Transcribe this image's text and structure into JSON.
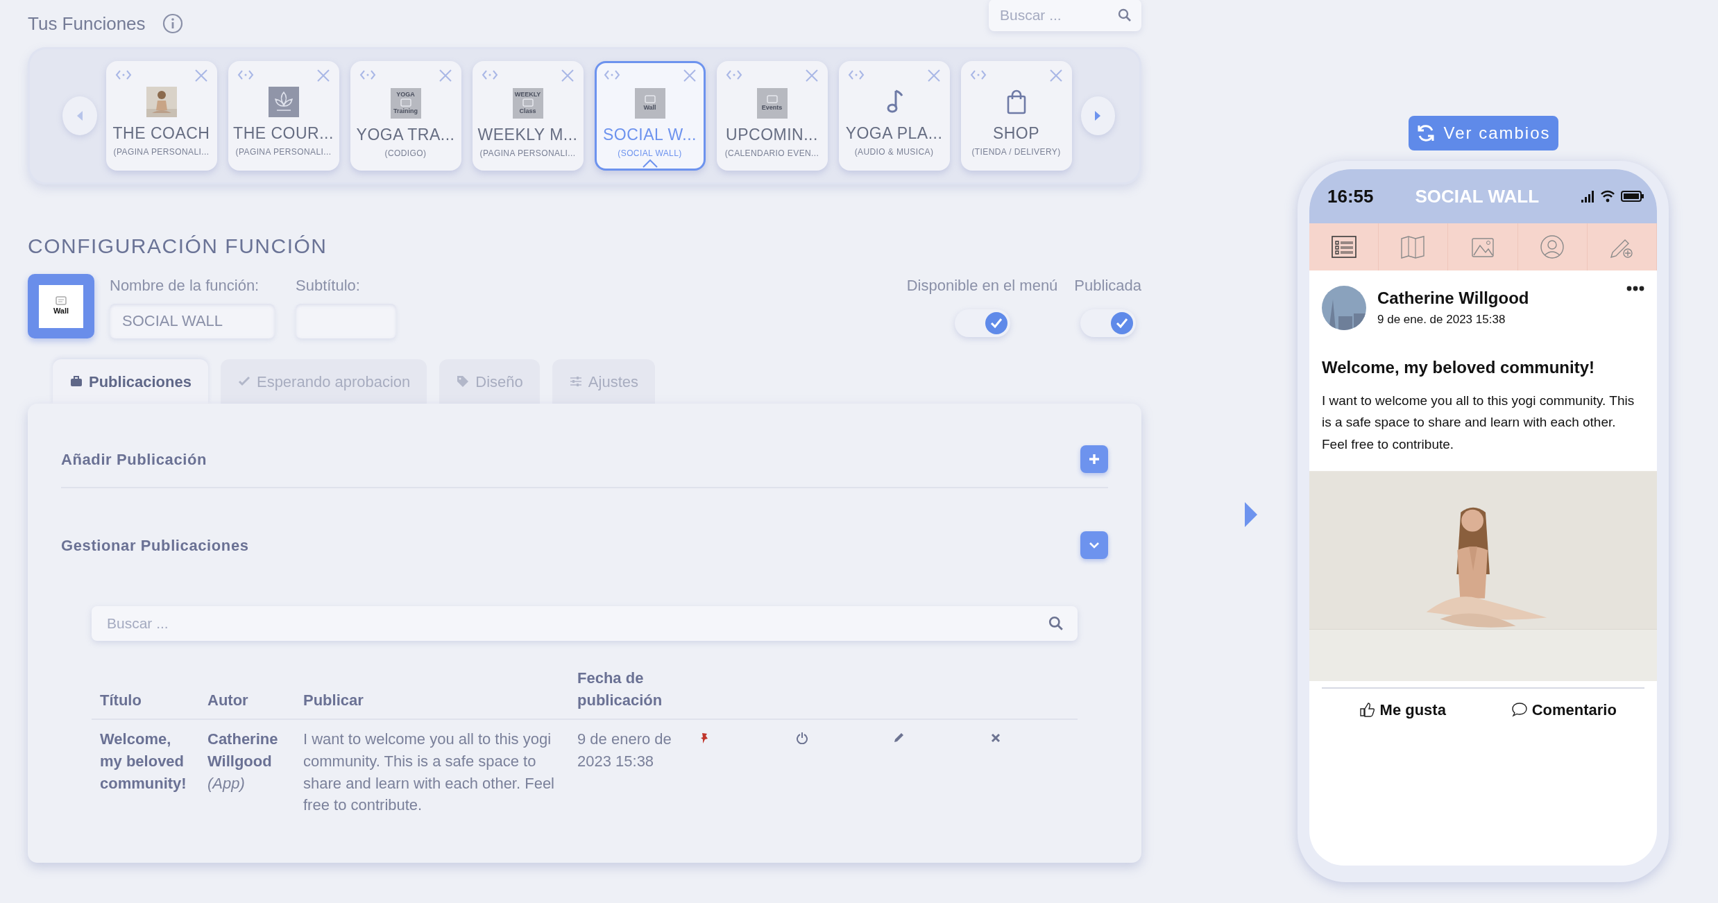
{
  "header": {
    "title": "Tus Funciones",
    "search": {
      "placeholder": "Buscar ..."
    }
  },
  "functions": [
    {
      "title": "THE COACH",
      "subtitle": "(PAGINA PERSONALI...",
      "selected": false
    },
    {
      "title": "THE COUR...",
      "subtitle": "(PAGINA PERSONALI...",
      "thumb": {
        "kind": "lotus"
      },
      "selected": false
    },
    {
      "title": "YOGA TRA...",
      "subtitle": "(CODIGO)",
      "thumb": {
        "kind": "label",
        "top": "YOGA",
        "bottom": "Training"
      },
      "selected": false
    },
    {
      "title": "WEEKLY M...",
      "subtitle": "(PAGINA PERSONALI...",
      "thumb": {
        "kind": "label",
        "top": "WEEKLY",
        "bottom": "Class"
      },
      "selected": false
    },
    {
      "title": "SOCIAL W...",
      "subtitle": "(SOCIAL WALL)",
      "thumb": {
        "kind": "label",
        "bottom": "Wall"
      },
      "selected": true
    },
    {
      "title": "UPCOMIN...",
      "subtitle": "(CALENDARIO EVEN...",
      "thumb": {
        "kind": "label",
        "bottom": "Events"
      },
      "selected": false
    },
    {
      "title": "YOGA PLA...",
      "subtitle": "(AUDIO & MUSICA)",
      "thumb": {
        "kind": "music"
      },
      "selected": false
    },
    {
      "title": "SHOP",
      "subtitle": "(TIENDA / DELIVERY)",
      "thumb": {
        "kind": "bag"
      },
      "selected": false
    }
  ],
  "config": {
    "title": "CONFIGURACIÓN FUNCIÓN",
    "icon_label": "Wall",
    "fields": [
      {
        "label": "Nombre de la función:",
        "value": "SOCIAL WALL"
      },
      {
        "label": "Subtítulo:"
      }
    ],
    "toggles": [
      {
        "label": "Disponible en el menú",
        "checked": true
      },
      {
        "label": "Publicada",
        "checked": true
      }
    ]
  },
  "tabs": [
    {
      "label": "Publicaciones",
      "kind": "briefcase",
      "selected": true
    },
    {
      "label": "Esperando aprobacion",
      "kind": "check",
      "selected": false
    },
    {
      "label": "Diseño",
      "kind": "tag",
      "selected": false
    },
    {
      "label": "Ajustes",
      "kind": "sliders",
      "selected": false
    }
  ],
  "sections": [
    {
      "title": "Añadir Publicación",
      "kind": "add"
    },
    {
      "title": "Gestionar Publicaciones",
      "kind": "expand"
    }
  ],
  "posts_search": {
    "placeholder": "Buscar ..."
  },
  "table": {
    "columns": [
      "Título",
      "Autor",
      "Publicar",
      "Fecha de publicación"
    ],
    "rows": [
      {
        "title": "Welcome, my beloved community!",
        "author": "Catherine Willgood",
        "author_note": "(App)",
        "text": "I want to welcome you all to this yogi community. This is a safe space to share and learn with each other. Feel free to contribute.",
        "date": "9 de enero de 2023 15:38",
        "actions": [
          {
            "kind": "pin"
          },
          {
            "kind": "power"
          },
          {
            "kind": "edit"
          },
          {
            "kind": "delete"
          }
        ]
      }
    ]
  },
  "preview": {
    "button": "Ver cambios",
    "status_time": "16:55",
    "app_title": "SOCIAL WALL",
    "nav": [
      {
        "kind": "list",
        "selected": true
      },
      {
        "kind": "map",
        "selected": false
      },
      {
        "kind": "gallery",
        "selected": false
      },
      {
        "kind": "profile",
        "selected": false
      },
      {
        "kind": "compose",
        "selected": false
      }
    ],
    "post": {
      "author": "Catherine Willgood",
      "date": "9 de ene. de 2023 15:38",
      "heading": "Welcome, my beloved community!",
      "body": "I want to welcome you all to this yogi community. This is a safe space to share and learn with each other. Feel free to contribute.",
      "actions": [
        {
          "kind": "like",
          "label": "Me gusta"
        },
        {
          "kind": "comment",
          "label": "Comentario"
        }
      ]
    }
  }
}
